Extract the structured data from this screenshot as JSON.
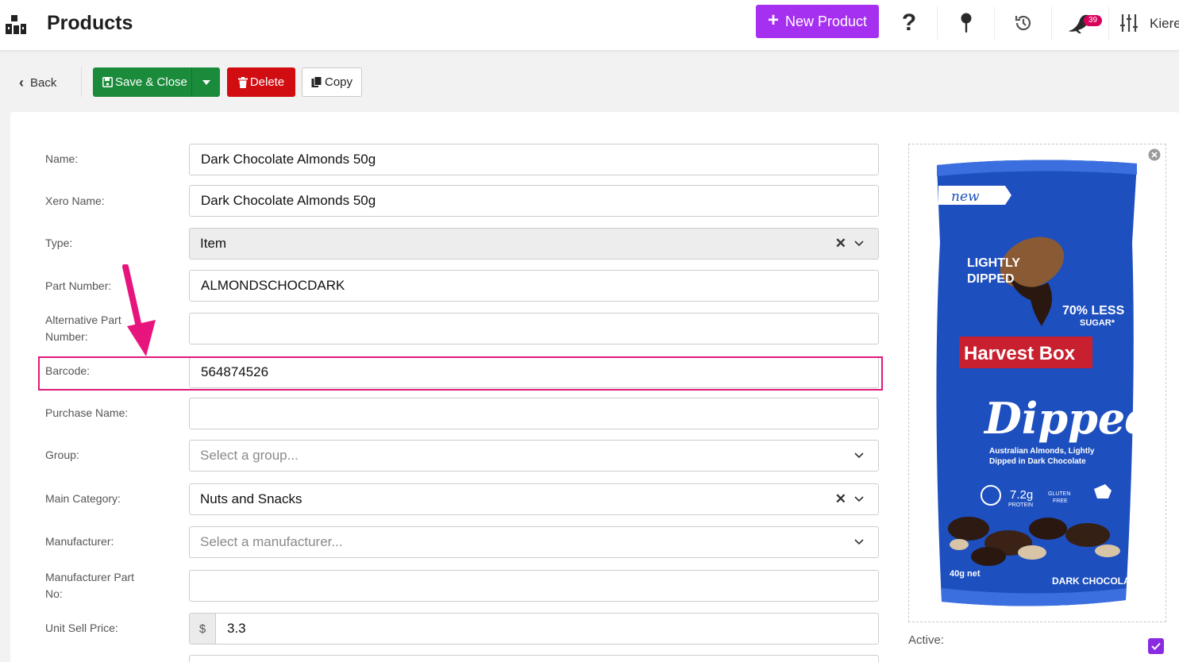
{
  "header": {
    "title": "Products",
    "new_button_label": "New Product",
    "help_glyph": "?",
    "notification_count": "39",
    "user_name": "Kiere",
    "icons": [
      "logo-icon",
      "help-icon",
      "pin-icon",
      "history-icon",
      "bird-icon",
      "sliders-icon"
    ]
  },
  "toolbar": {
    "back_label": "Back",
    "save_label": "Save & Close",
    "delete_label": "Delete",
    "copy_label": "Copy"
  },
  "form": {
    "name": {
      "label": "Name:",
      "value": "Dark Chocolate Almonds 50g"
    },
    "xero_name": {
      "label": "Xero Name:",
      "value": "Dark Chocolate Almonds 50g"
    },
    "type": {
      "label": "Type:",
      "value": "Item"
    },
    "part_number": {
      "label": "Part Number:",
      "value": "ALMONDSCHOCDARK"
    },
    "alt_part_number": {
      "label_line1": "Alternative Part",
      "label_line2": "Number:",
      "value": ""
    },
    "barcode": {
      "label": "Barcode:",
      "value": "564874526"
    },
    "purchase_name": {
      "label": "Purchase Name:",
      "value": ""
    },
    "group": {
      "label": "Group:",
      "placeholder": "Select a group..."
    },
    "main_category": {
      "label": "Main Category:",
      "value": "Nuts and Snacks"
    },
    "manufacturer": {
      "label": "Manufacturer:",
      "placeholder": "Select a manufacturer..."
    },
    "manufacturer_part_no": {
      "label_line1": "Manufacturer Part",
      "label_line2": "No:",
      "value": ""
    },
    "unit_sell_price": {
      "label": "Unit Sell Price:",
      "currency": "$",
      "value": "3.3"
    }
  },
  "side": {
    "active_label": "Active:",
    "active_checked": true
  },
  "product_image": {
    "tag": "new",
    "brand": "Harvest Box",
    "product": "Dipped",
    "subtitle_line1": "Australian Almonds, Lightly",
    "subtitle_line2": "Dipped in Dark Chocolate",
    "claim_line1": "LIGHTLY",
    "claim_line2": "DIPPED",
    "sugar_claim_line1": "70% LESS",
    "sugar_claim_line2": "SUGAR*",
    "protein": "7.2g",
    "protein_label": "PROTEIN",
    "gluten_line1": "GLUTEN",
    "gluten_line2": "FREE",
    "net_weight": "40g net",
    "flavour": "DARK CHOCOLATE"
  },
  "colors": {
    "new_button": "#a630f0",
    "save_button": "#1a8b3b",
    "delete_button": "#d10d12",
    "highlight": "#e0197a",
    "badge": "#d9005b",
    "checkbox": "#8a2be2",
    "pack_blue": "#1d4fbf",
    "brand_red": "#c8202f"
  }
}
